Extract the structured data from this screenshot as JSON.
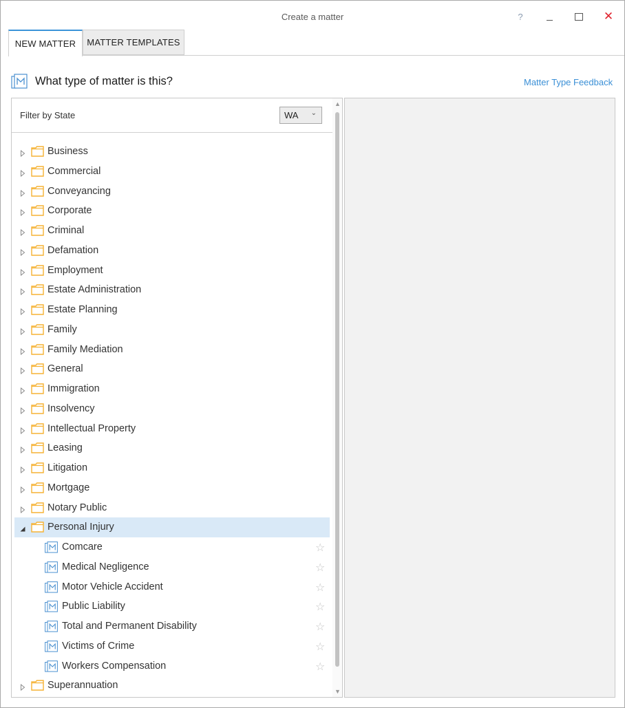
{
  "window": {
    "title": "Create a matter",
    "help_label": "?"
  },
  "tabs": [
    {
      "label": "NEW MATTER",
      "active": true
    },
    {
      "label": "MATTER TEMPLATES",
      "active": false
    }
  ],
  "header": {
    "question": "What type of matter is this?",
    "feedback_link": "Matter Type Feedback"
  },
  "filter": {
    "label": "Filter by State",
    "selected_state": "WA"
  },
  "tree": {
    "categories": [
      "Business",
      "Commercial",
      "Conveyancing",
      "Corporate",
      "Criminal",
      "Defamation",
      "Employment",
      "Estate Administration",
      "Estate Planning",
      "Family",
      "Family Mediation",
      "General",
      "Immigration",
      "Insolvency",
      "Intellectual Property",
      "Leasing",
      "Litigation",
      "Mortgage",
      "Notary Public"
    ],
    "expanded": {
      "label": "Personal Injury",
      "children": [
        "Comcare",
        "Medical Negligence",
        "Motor Vehicle Accident",
        "Public Liability",
        "Total and Permanent Disability",
        "Victims of Crime",
        "Workers Compensation"
      ]
    },
    "after": [
      "Superannuation"
    ]
  },
  "colors": {
    "accent": "#3a93d8",
    "folder": "#f5b234",
    "selected_row": "#d9e9f7",
    "close": "#e0242f"
  },
  "icons": {
    "category": "folder-icon",
    "matter_type": "matter-type-icon",
    "favorite": "star-icon"
  }
}
